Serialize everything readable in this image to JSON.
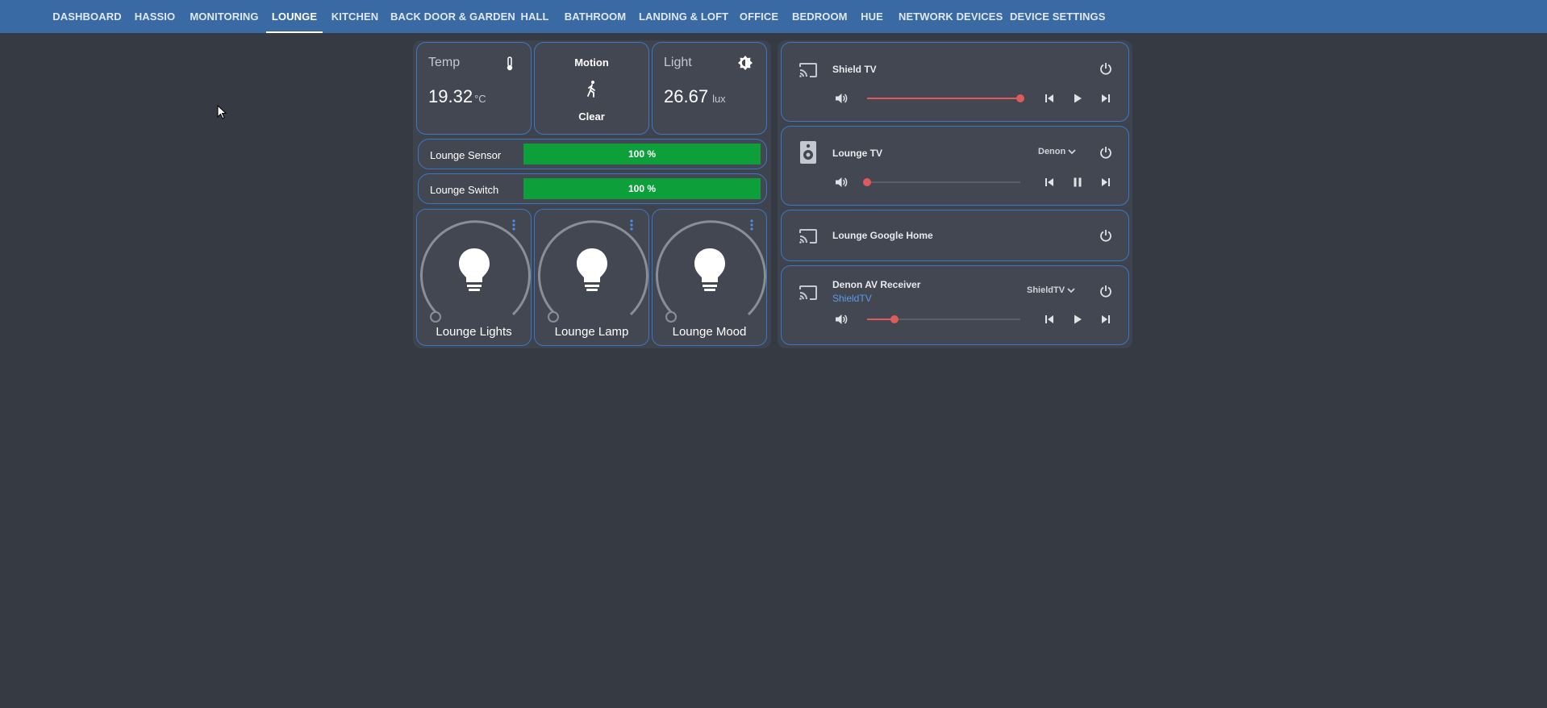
{
  "nav": {
    "tabs": [
      {
        "label": "DASHBOARD"
      },
      {
        "label": "HASSIO"
      },
      {
        "label": "MONITORING"
      },
      {
        "label": "LOUNGE",
        "active": true
      },
      {
        "label": "KITCHEN"
      },
      {
        "label": "BACK DOOR & GARDEN"
      },
      {
        "label": "HALL"
      },
      {
        "label": "BATHROOM"
      },
      {
        "label": "LANDING & LOFT"
      },
      {
        "label": "OFFICE"
      },
      {
        "label": "BEDROOM"
      },
      {
        "label": "HUE"
      },
      {
        "label": "NETWORK DEVICES"
      },
      {
        "label": "DEVICE SETTINGS"
      }
    ]
  },
  "sensors": {
    "temp": {
      "title": "Temp",
      "value": "19.32",
      "unit": "°C",
      "icon": "thermometer-icon"
    },
    "motion": {
      "title": "Motion",
      "state": "Clear",
      "icon": "walking-person-icon"
    },
    "light": {
      "title": "Light",
      "value": "26.67",
      "unit": "lux",
      "icon": "brightness-icon"
    }
  },
  "bars": [
    {
      "label": "Lounge Sensor",
      "value": 100,
      "text": "100 %"
    },
    {
      "label": "Lounge Switch",
      "value": 100,
      "text": "100 %"
    }
  ],
  "lights": [
    {
      "name": "Lounge Lights",
      "brightness": 0
    },
    {
      "name": "Lounge Lamp",
      "brightness": 0
    },
    {
      "name": "Lounge Mood",
      "brightness": 0
    }
  ],
  "media": [
    {
      "name": "Shield TV",
      "icon": "cast-icon",
      "volume": 1.0,
      "playing": false
    },
    {
      "name": "Lounge TV",
      "icon": "speaker-icon",
      "source": "Denon",
      "volume": 0.0,
      "playing": true
    },
    {
      "name": "Lounge Google Home",
      "icon": "cast-icon"
    },
    {
      "name": "Denon AV Receiver",
      "subtitle": "ShieldTV",
      "icon": "cast-icon",
      "source": "ShieldTV",
      "volume": 0.18,
      "playing": false
    }
  ],
  "colors": {
    "topbar": "#3a6aa3",
    "background": "#363a43",
    "card_border": "#3b78c4",
    "bar_fill": "#0d9f3a",
    "slider": "#e05a5a",
    "accent_link": "#5b9bea"
  }
}
